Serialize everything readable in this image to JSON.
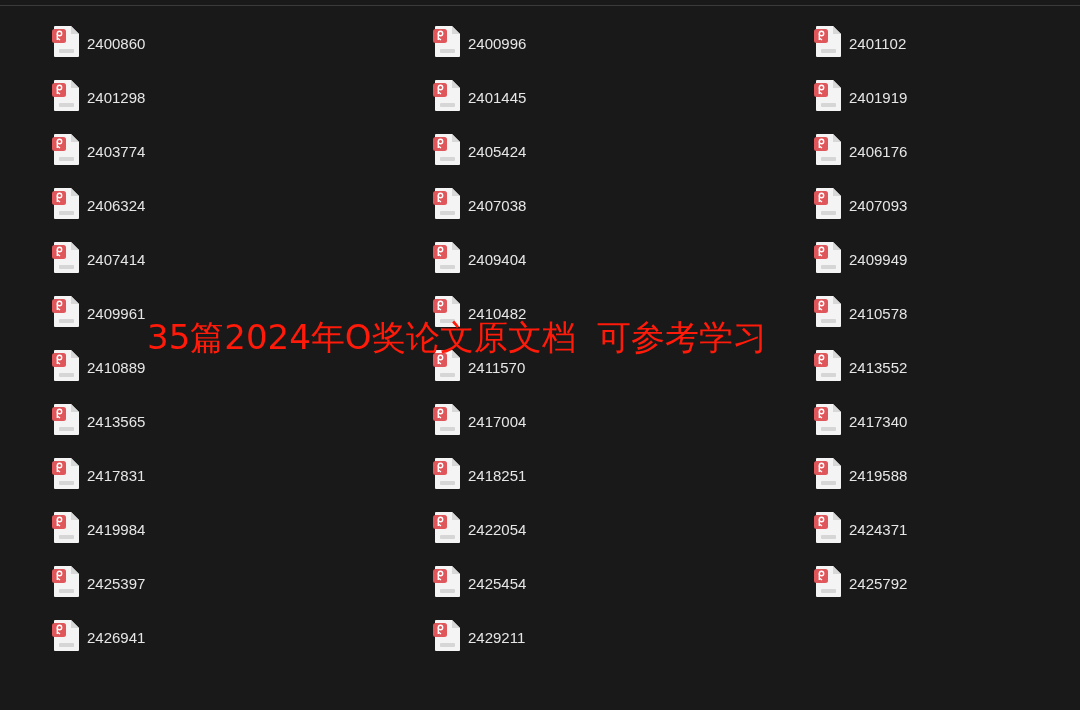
{
  "files": [
    {
      "name": "2400860"
    },
    {
      "name": "2400996"
    },
    {
      "name": "2401102"
    },
    {
      "name": "2401298"
    },
    {
      "name": "2401445"
    },
    {
      "name": "2401919"
    },
    {
      "name": "2403774"
    },
    {
      "name": "2405424"
    },
    {
      "name": "2406176"
    },
    {
      "name": "2406324"
    },
    {
      "name": "2407038"
    },
    {
      "name": "2407093"
    },
    {
      "name": "2407414"
    },
    {
      "name": "2409404"
    },
    {
      "name": "2409949"
    },
    {
      "name": "2409961"
    },
    {
      "name": "2410482"
    },
    {
      "name": "2410578"
    },
    {
      "name": "2410889"
    },
    {
      "name": "2411570"
    },
    {
      "name": "2413552"
    },
    {
      "name": "2413565"
    },
    {
      "name": "2417004"
    },
    {
      "name": "2417340"
    },
    {
      "name": "2417831"
    },
    {
      "name": "2418251"
    },
    {
      "name": "2419588"
    },
    {
      "name": "2419984"
    },
    {
      "name": "2422054"
    },
    {
      "name": "2424371"
    },
    {
      "name": "2425397"
    },
    {
      "name": "2425454"
    },
    {
      "name": "2425792"
    },
    {
      "name": "2426941"
    },
    {
      "name": "2429211"
    }
  ],
  "overlay_caption": "35篇2024年O奖论文原文档  可参考学习"
}
